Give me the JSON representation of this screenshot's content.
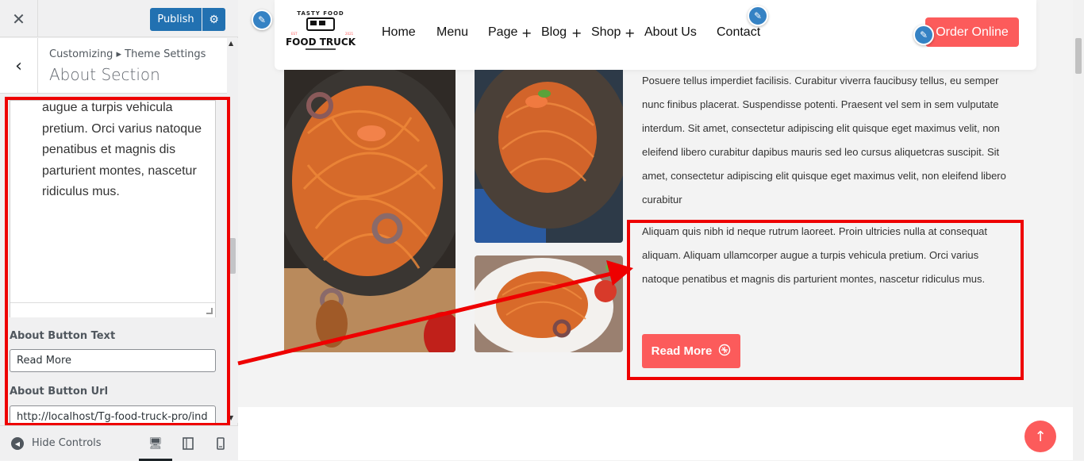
{
  "customizer": {
    "publish_label": "Publish",
    "breadcrumb": "Customizing ▸ Theme Settings",
    "section_title": "About Section",
    "textarea_value": "augue a turpis vehicula pretium. Orci varius natoque penatibus et magnis dis parturient montes, nascetur ridiculus mus.",
    "button_text_label": "About Button Text",
    "button_text_value": "Read More",
    "button_url_label": "About Button Url",
    "button_url_value": "http://localhost/Tg-food-truck-pro/ind",
    "hide_controls": "Hide Controls"
  },
  "site": {
    "logo_top": "TASTY FOOD",
    "logo_main": "FOOD TRUCK",
    "nav": [
      {
        "label": "Home"
      },
      {
        "label": "Menu"
      },
      {
        "label": "Page"
      },
      {
        "label": "Blog"
      },
      {
        "label": "Shop"
      },
      {
        "label": "About Us"
      },
      {
        "label": "Contact"
      }
    ],
    "order_button": "Order Online",
    "about_para1": "Posuere tellus imperdiet facilisis. Curabitur viverra faucibusy tellus, eu semper nunc finibus placerat. Suspendisse potenti. Praesent vel sem in sem vulputate interdum. Sit amet, consectetur adipiscing elit quisque eget maximus velit, non eleifend libero curabitur dapibus mauris sed leo cursus aliquetcras suscipit. Sit amet, consectetur adipiscing elit quisque eget maximus velit, non eleifend libero curabitur",
    "about_para2": "Aliquam quis nibh id neque rutrum laoreet. Proin ultricies nulla at consequat aliquam. Aliquam ullamcorper augue a turpis vehicula pretium. Orci varius natoque penatibus et magnis dis parturient montes, nascetur ridiculus mus.",
    "read_more": "Read More"
  },
  "colors": {
    "accent": "#fc5b5b",
    "wp_blue": "#2271b1",
    "annotation_red": "#e00000"
  }
}
